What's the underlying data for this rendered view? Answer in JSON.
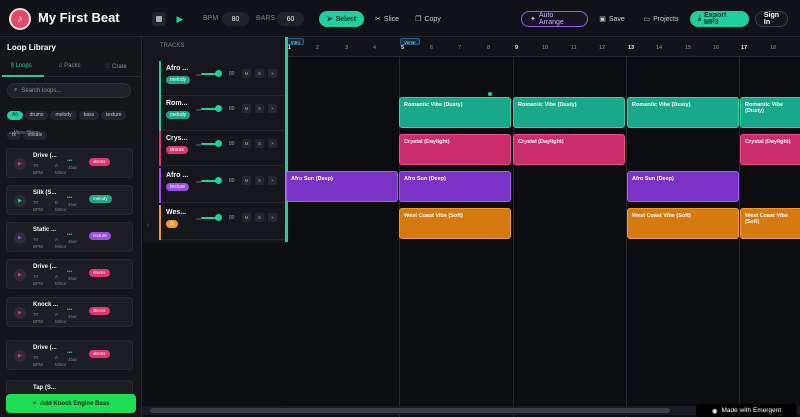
{
  "header": {
    "title": "My First Beat",
    "bpm_label": "BPM",
    "bpm_value": "80",
    "bars_label": "BARS",
    "bars_value": "60",
    "tools": [
      "Select",
      "Slice",
      "Copy"
    ],
    "auto_arrange": "Auto Arrange",
    "save": "Save",
    "projects": "Projects",
    "export": "Export MP3",
    "sign_in": "Sign In"
  },
  "sidebar": {
    "title": "Loop Library",
    "tabs": [
      "Loops",
      "Packs",
      "Crate"
    ],
    "search_placeholder": "Search loops...",
    "chips": [
      "All",
      "drums",
      "melody",
      "bass",
      "texture",
      "fx",
      "vocals"
    ],
    "more_filters": "More filters",
    "loops": [
      {
        "name": "Drive (...",
        "bpm": "70",
        "key": "A",
        "unit": "BPM",
        "mode": "Minor",
        "bars": "4bar",
        "tag": "drums"
      },
      {
        "name": "Silk (S...",
        "bpm": "70",
        "key": "E",
        "unit": "BPM",
        "mode": "Minor",
        "bars": "4bar",
        "tag": "melody"
      },
      {
        "name": "Static ...",
        "bpm": "70",
        "key": "A",
        "unit": "BPM",
        "mode": "Minor",
        "bars": "4bar",
        "tag": "texture"
      },
      {
        "name": "Drive (...",
        "bpm": "70",
        "key": "A",
        "unit": "BPM",
        "mode": "Minor",
        "bars": "4bar",
        "tag": "drums"
      },
      {
        "name": "Knock ...",
        "bpm": "70",
        "key": "A",
        "unit": "BPM",
        "mode": "Minor",
        "bars": "4bar",
        "tag": "drums"
      },
      {
        "name": "Drive (...",
        "bpm": "70",
        "key": "A",
        "unit": "BPM",
        "mode": "Minor",
        "bars": "4bar",
        "tag": "drums"
      },
      {
        "name": "Tap (S..."
      }
    ],
    "add_button": "Add Knock Engine Bass"
  },
  "tracks": {
    "title": "TRACKS",
    "rows": [
      {
        "name": "Afro ...",
        "tag": "melody",
        "vol_label": "vol",
        "volume": "80"
      },
      {
        "name": "Rom...",
        "tag": "melody",
        "vol_label": "vol",
        "volume": "80"
      },
      {
        "name": "Crys...",
        "tag": "drums",
        "vol_label": "vol",
        "volume": "80"
      },
      {
        "name": "Afro ...",
        "tag": "texture",
        "vol_label": "vol",
        "volume": "80"
      },
      {
        "name": "Wes...",
        "tag": "fx",
        "vol_label": "vol",
        "volume": "80"
      }
    ],
    "mute": "M",
    "solo": "S",
    "remove": "×"
  },
  "timeline": {
    "bar_numbers": [
      "1",
      "2",
      "3",
      "4",
      "5",
      "6",
      "7",
      "8",
      "9",
      "10",
      "11",
      "12",
      "13",
      "14",
      "15",
      "16",
      "17",
      "18"
    ],
    "sections": [
      "Intro",
      "Verse"
    ],
    "clips": {
      "romantic": "Romantic Vibe (Dusty)",
      "crystal": "Crystal (Daylight)",
      "afro": "Afro Sun (Deep)",
      "westcoast": "West Coast Vibe (Soft)"
    }
  },
  "footer": {
    "badge": "Made with Emergent"
  },
  "colors": {
    "accent": "#1fcf9f",
    "green_button": "#1fdd55",
    "drums": "#e0356f",
    "melody": "#1fcf9f",
    "texture": "#9a4de8",
    "fx": "#f59a2a"
  }
}
